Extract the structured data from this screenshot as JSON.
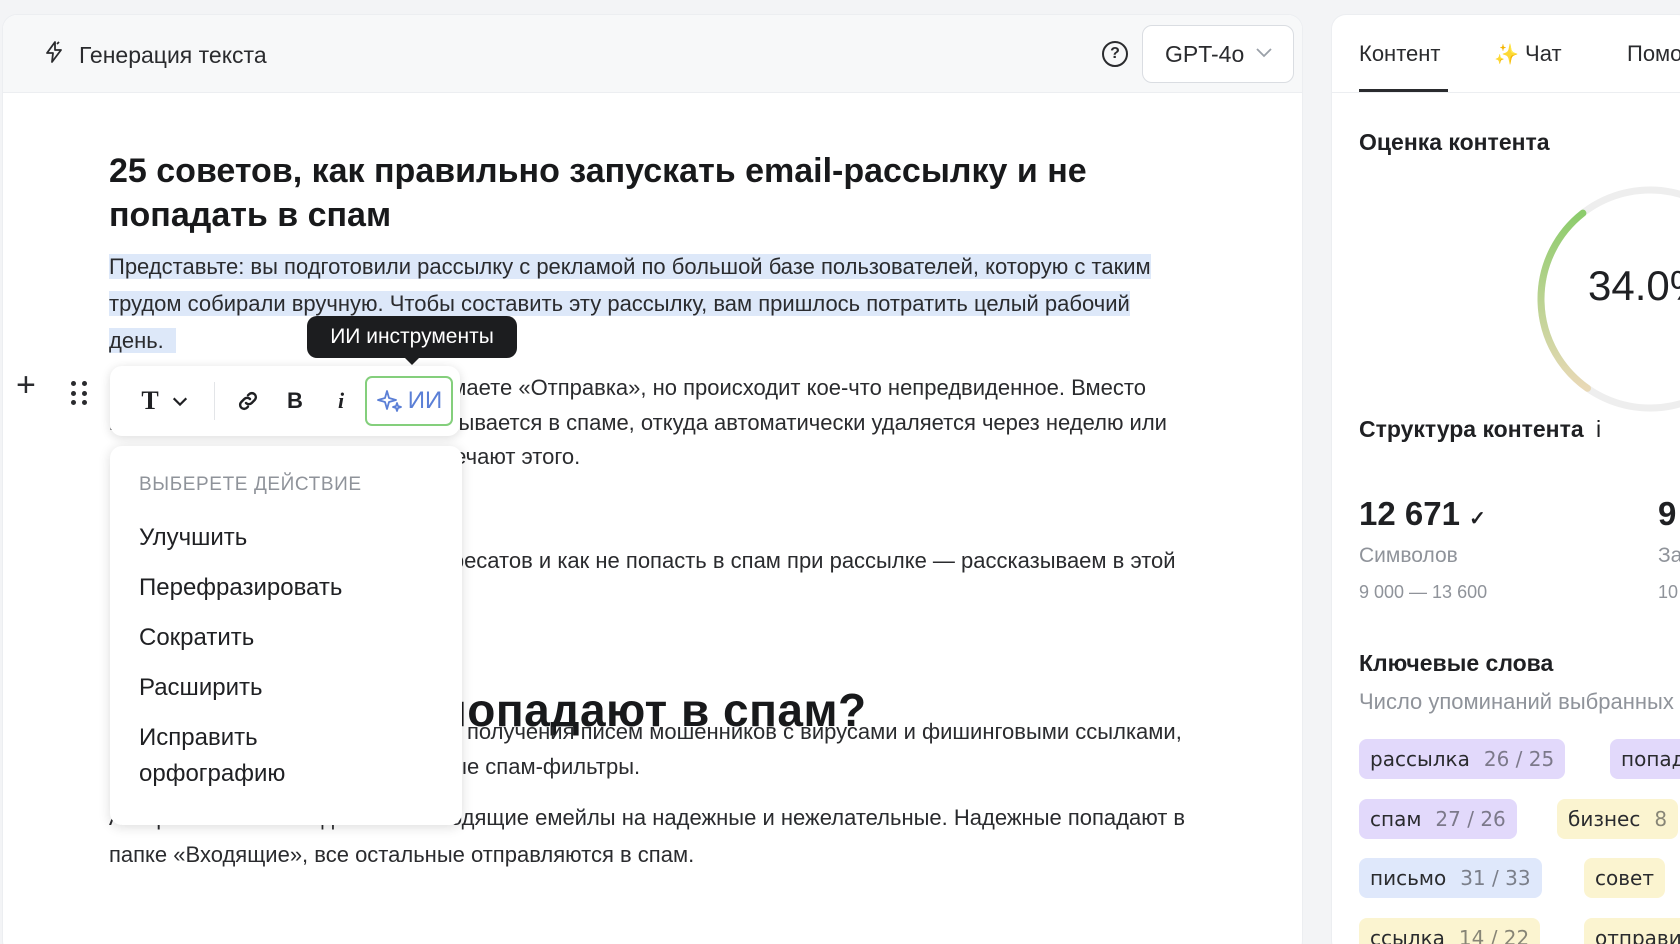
{
  "editor": {
    "title": "Генерация текста",
    "help": "?",
    "model": "GPT-4o"
  },
  "article": {
    "h1": "25 советов, как правильно запускать email-рассылку и не попадать в спам",
    "p1_lines": [
      "Представьте: вы подготовили рассылку с рекламой по большой базе пользователей, которую с таким",
      "трудом собирали вручную. Чтобы составить эту рассылку, вам пришлось потратить целый рабочий",
      "день."
    ],
    "p2_lines": [
      "имаете «Отправка», но происходит кое-что непредвиденное. Вместо",
      "папки «Входящие» ваш email оказывается в спаме, откуда автоматически удаляется через неделю или",
      "мечают этого."
    ],
    "p3_line": "дресатов и как не попасть в спам при рассылке — рассказываем в этой",
    "h2": "попадают в спам?",
    "p4_lines": [
      "от получения писем мошенников с вирусами и фишинговыми ссылками,",
      "ные спам-фильтры."
    ],
    "p5_lines": [
      "Алгоритмы системы делят все входящие емейлы на надежные и нежелательные. Надежные попадают в",
      "папке «Входящие», все остальные отправляются в спам."
    ]
  },
  "toolbar": {
    "text_style": "T",
    "bold": "B",
    "italic": "i",
    "ai_label": "ИИ",
    "tooltip": "ИИ инструменты"
  },
  "ai_menu": {
    "title": "ВЫБЕРЕТЕ ДЕЙСТВИЕ",
    "items": [
      "Улучшить",
      "Перефразировать",
      "Сократить",
      "Расширить",
      "Исправить орфографию"
    ]
  },
  "sidebar": {
    "tabs": [
      "Контент",
      "Чат",
      "Помо"
    ],
    "score_title": "Оценка контента",
    "score_value": "34.0%",
    "score_fraction": 0.34,
    "structure_title": "Структура контента",
    "structure_info": "i",
    "stats": [
      {
        "value": "12 671",
        "check": "✓",
        "label": "Символов",
        "range": "9 000 — 13 600"
      },
      {
        "value": "9",
        "label": "За",
        "range": "10"
      }
    ],
    "keywords_title": "Ключевые слова",
    "keywords_subtitle": "Число упоминаний выбранных",
    "keywords": [
      {
        "word": "рассылка",
        "count": "26  /  25"
      },
      {
        "word": "попад",
        "count": ""
      },
      {
        "word": "спам",
        "count": "27  /  26"
      },
      {
        "word": "бизнес",
        "count": "8"
      },
      {
        "word": "письмо",
        "count": "31  /  33"
      },
      {
        "word": "совет",
        "count": ""
      },
      {
        "word": "ссылка",
        "count": "14  /  22"
      },
      {
        "word": "отправи",
        "count": ""
      }
    ]
  },
  "colors": {
    "selection": "#dde8f9",
    "ai_border": "#84cf7c",
    "ai_text": "#5b7fd6",
    "gauge_green": "#8ccc6c",
    "gauge_track": "#eeeeee"
  }
}
